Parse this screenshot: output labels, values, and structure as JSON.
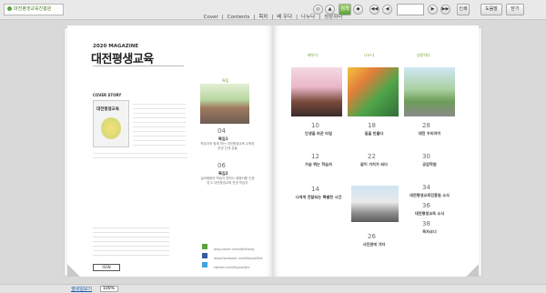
{
  "header": {
    "logo_text": "대전평생교육진흥원",
    "toc_links": [
      "Cover",
      "Contents",
      "목차",
      "배 우다",
      "나누다",
      "성장하다"
    ],
    "toc_sep": "|",
    "nav_buttons": [
      "◀◀",
      "◀",
      "▶",
      "▶▶"
    ],
    "search_label": "검색",
    "tool_buttons": [
      "인쇄",
      "도움말",
      "닫기"
    ],
    "round_buttons": [
      "◎",
      "▲",
      "◆"
    ]
  },
  "left_page": {
    "year_magazine": "2020 MAGAZINE",
    "title": "대전평생교육",
    "cover_story_label": "COVER STORY",
    "cover_mag_title": "대전평생교육",
    "section_label": "특집",
    "article_04_num": "04",
    "article_04_cat": "특집1",
    "article_04_text": "학습자와 함께 하는 대전평생교육 교육장 운영 관계 분들",
    "article_06_num": "06",
    "article_06_cat": "특집2",
    "article_06_text": "실버배움의 학습자 원하는 배움터를 인증받고 대전평생교육 운영 학습자",
    "social_blog": "blog.naver.com/djlifelong",
    "social_facebook": "www.facebook.com/MaybeDile",
    "social_twitter": "twitter.com/MaybeDile"
  },
  "right_page": {
    "col_headers": [
      "배우다",
      "나누다",
      "성장하다"
    ],
    "items": [
      {
        "num": "10",
        "title": "인생을 바꾼 타일"
      },
      {
        "num": "12",
        "title": "가슴 뛰는 학습자"
      },
      {
        "num": "14",
        "title": "나에게 전달되는 특별한 시간"
      },
      {
        "num": "18",
        "title": "길을 만들다"
      },
      {
        "num": "22",
        "title": "같이 가치가 되다"
      },
      {
        "num": "26",
        "title": "사진관에 가자"
      },
      {
        "num": "28",
        "title": "대전 우리아이"
      },
      {
        "num": "30",
        "title": "공감학원"
      },
      {
        "num": "34",
        "title": "대전평생교육진흥원 소식"
      },
      {
        "num": "36",
        "title": "대전평생교육 소식"
      },
      {
        "num": "38",
        "title": "독자코너"
      }
    ]
  },
  "footer": {
    "thumbnail_link": "썸네일보기",
    "zoom_value": "100%"
  }
}
